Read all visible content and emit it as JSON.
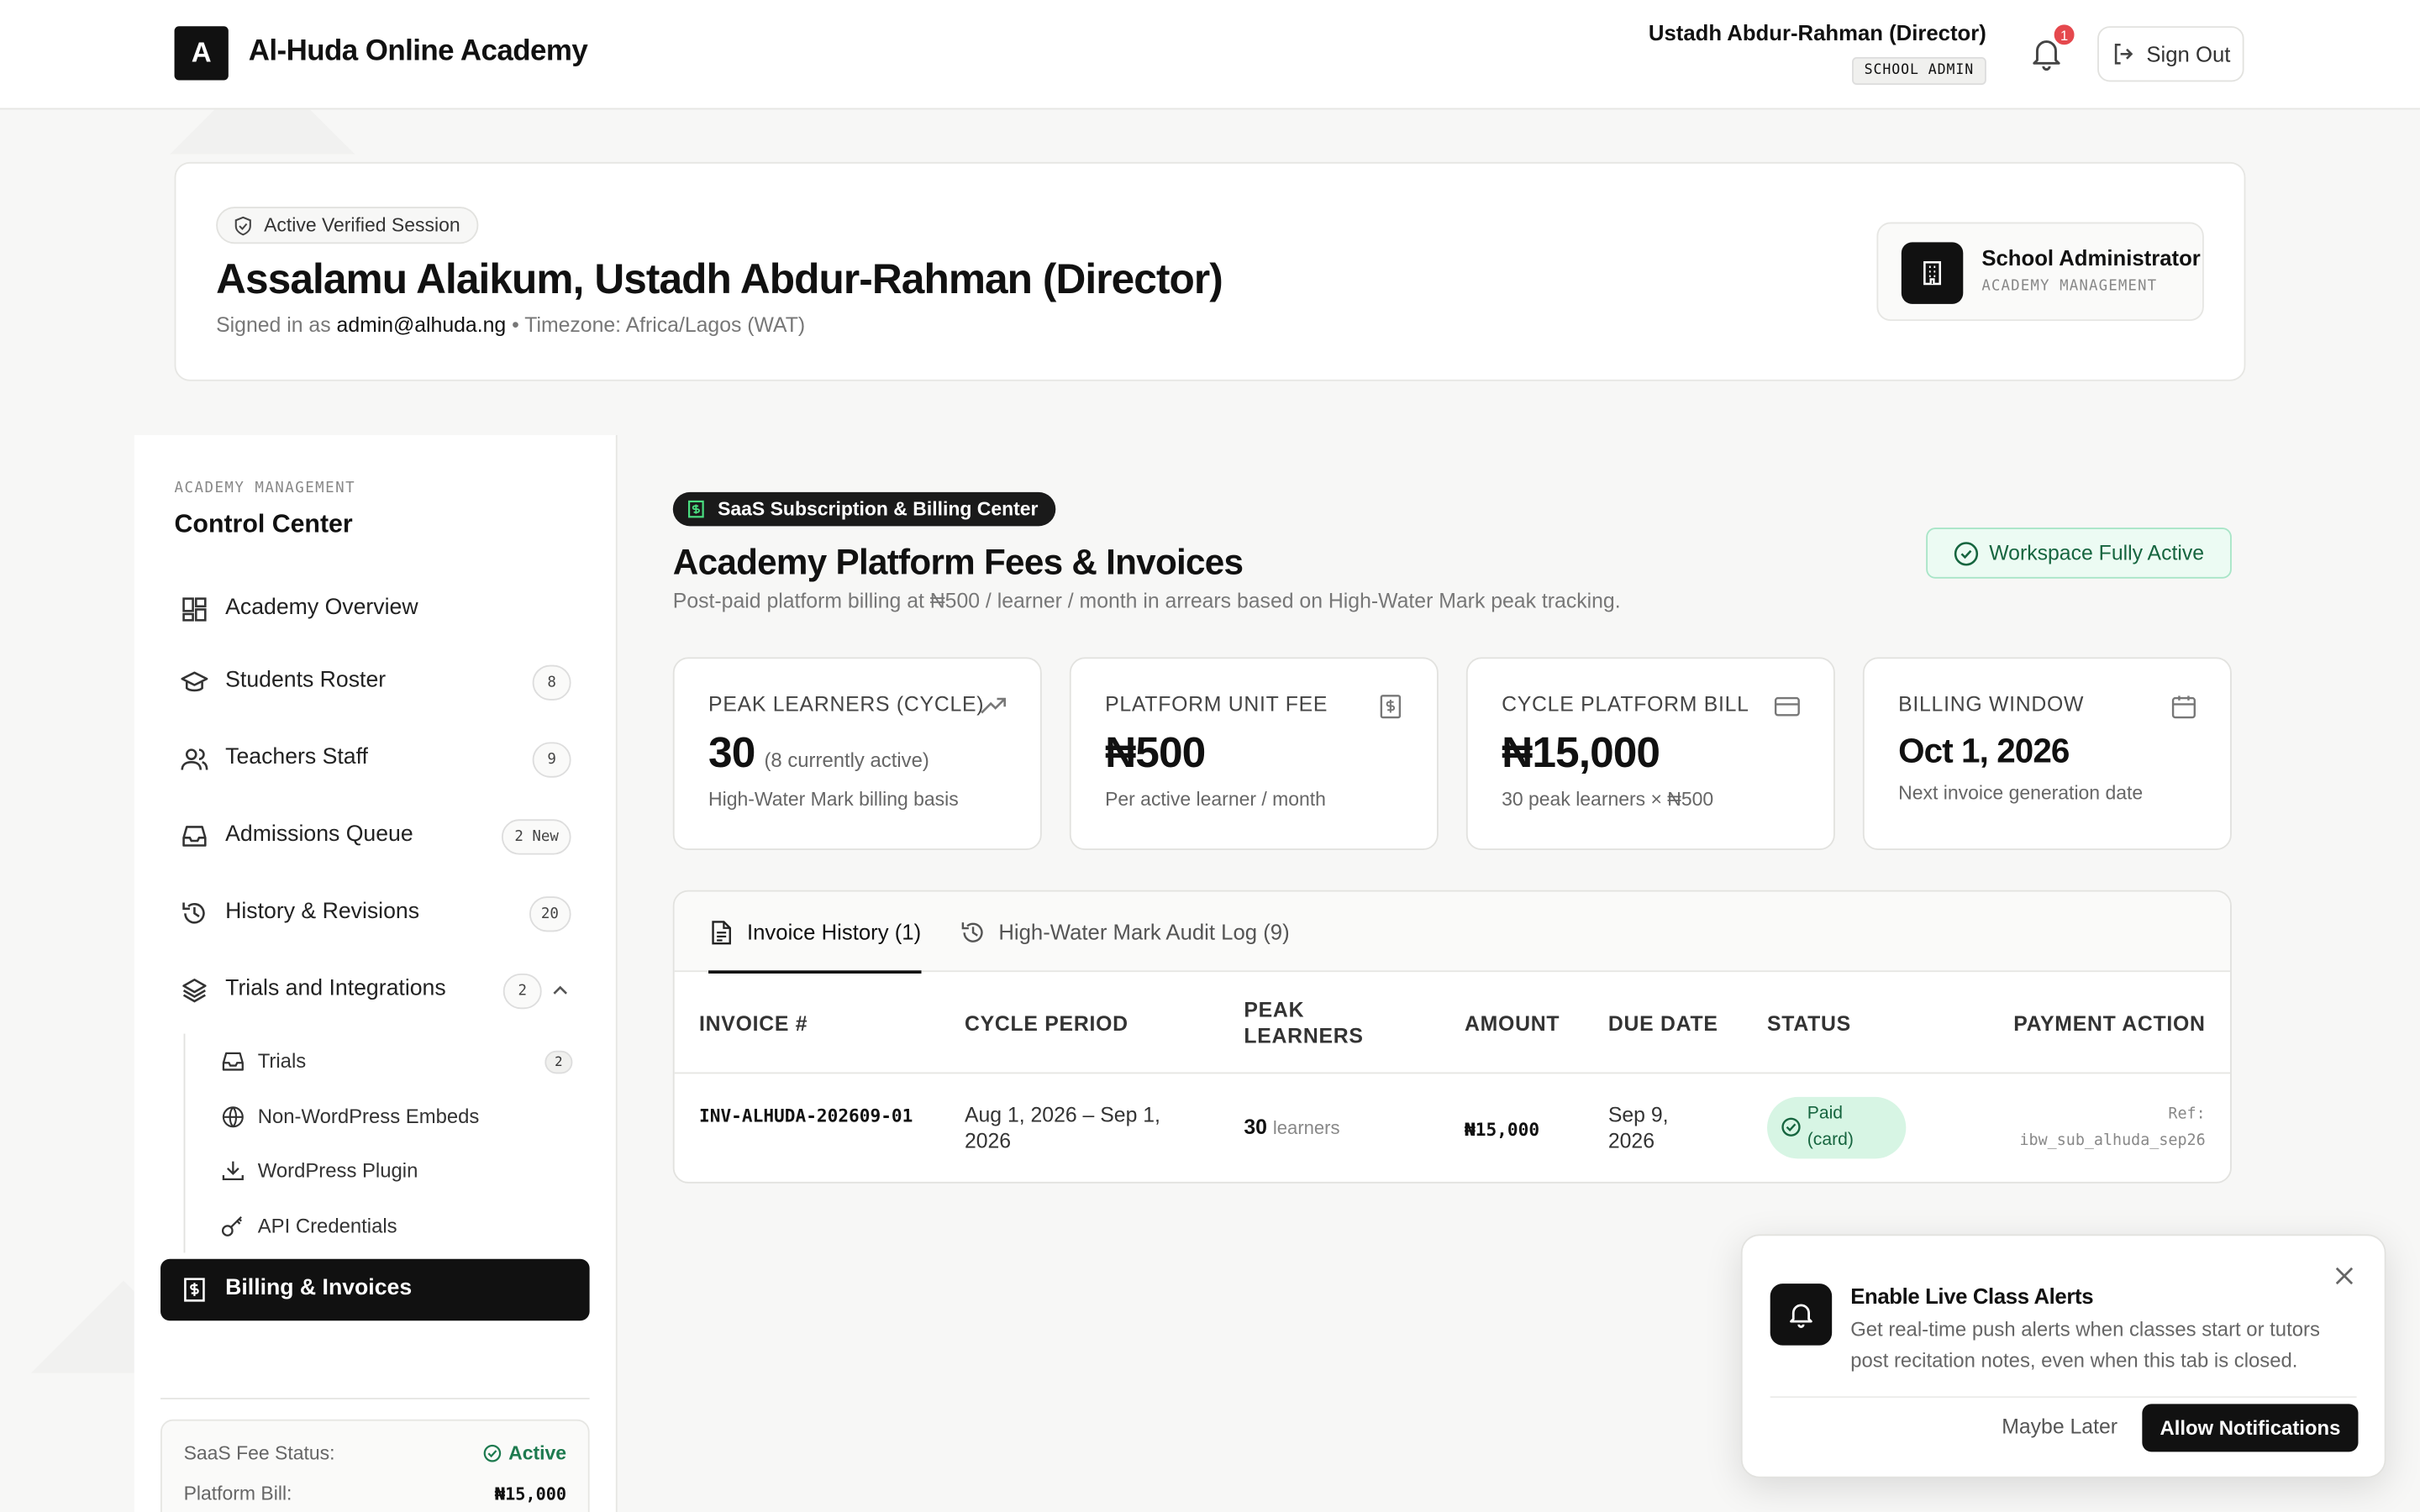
{
  "header": {
    "logo_letter": "A",
    "brand": "Al-Huda Online Academy",
    "user_name": "Ustadh Abdur-Rahman (Director)",
    "user_role": "SCHOOL ADMIN",
    "notification_count": "1",
    "signout_label": "Sign Out"
  },
  "welcome": {
    "session_badge": "Active Verified Session",
    "greeting": "Assalamu Alaikum, Ustadh Abdur-Rahman (Director)",
    "signed_prefix": "Signed in as",
    "email": "admin@alhuda.ng",
    "timezone": "• Timezone: Africa/Lagos (WAT)",
    "role_title": "School Administrator",
    "role_sub": "ACADEMY MANAGEMENT"
  },
  "sidebar": {
    "kicker": "ACADEMY MANAGEMENT",
    "title": "Control Center",
    "items": [
      {
        "label": "Academy Overview",
        "icon": "dashboard-icon",
        "count": ""
      },
      {
        "label": "Students Roster",
        "icon": "graduation-cap-icon",
        "count": "8"
      },
      {
        "label": "Teachers Staff",
        "icon": "users-icon",
        "count": "9"
      },
      {
        "label": "Admissions Queue",
        "icon": "inbox-icon",
        "count": "2 New"
      },
      {
        "label": "History & Revisions",
        "icon": "history-icon",
        "count": "20"
      },
      {
        "label": "Trials and Integrations",
        "icon": "layers-icon",
        "count": "2"
      },
      {
        "label": "Billing & Invoices",
        "icon": "receipt-icon",
        "count": ""
      }
    ],
    "sub_items": [
      {
        "label": "Trials",
        "icon": "inbox-icon",
        "count": "2"
      },
      {
        "label": "Non-WordPress Embeds",
        "icon": "globe-icon",
        "count": ""
      },
      {
        "label": "WordPress Plugin",
        "icon": "download-icon",
        "count": ""
      },
      {
        "label": "API Credentials",
        "icon": "key-icon",
        "count": ""
      }
    ],
    "fee_status_label": "SaaS Fee Status:",
    "fee_status_value": "Active",
    "platform_bill_label": "Platform Bill:",
    "platform_bill_value": "₦15,000"
  },
  "main": {
    "section_pill": "SaaS Subscription & Billing Center",
    "title": "Academy Platform Fees & Invoices",
    "subtitle": "Post-paid platform billing at ₦500 / learner / month in arrears based on High-Water Mark peak tracking.",
    "workspace_status": "Workspace Fully Active",
    "stats": [
      {
        "label": "PEAK LEARNERS (CYCLE)",
        "icon": "trending-up-icon",
        "value": "30",
        "aside": "(8 currently active)",
        "caption": "High-Water Mark billing basis"
      },
      {
        "label": "PLATFORM UNIT FEE",
        "icon": "receipt-icon",
        "value": "₦500",
        "aside": "",
        "caption": "Per active learner / month"
      },
      {
        "label": "CYCLE PLATFORM BILL",
        "icon": "credit-card-icon",
        "value": "₦15,000",
        "aside": "",
        "caption": "30 peak learners × ₦500"
      },
      {
        "label": "BILLING WINDOW",
        "icon": "calendar-icon",
        "value": "Oct 1, 2026",
        "aside": "",
        "caption": "Next invoice generation date"
      }
    ],
    "tabs": [
      {
        "label": "Invoice History (1)",
        "icon": "file-text-icon"
      },
      {
        "label": "High-Water Mark Audit Log (9)",
        "icon": "history-icon"
      }
    ],
    "columns": [
      "INVOICE #",
      "CYCLE PERIOD",
      "PEAK LEARNERS",
      "AMOUNT",
      "DUE DATE",
      "STATUS",
      "PAYMENT ACTION"
    ],
    "rows": [
      {
        "invoice": "INV-ALHUDA-202609-01",
        "period": "Aug 1, 2026 – Sep 1, 2026",
        "peak": "30",
        "peak_unit": "learners",
        "amount": "₦15,000",
        "due": "Sep 9, 2026",
        "status": "Paid (card)",
        "ref_label": "Ref:",
        "ref": "ibw_sub_alhuda_sep26"
      }
    ]
  },
  "toast": {
    "title": "Enable Live Class Alerts",
    "body": "Get real-time push alerts when classes start or tutors post recitation notes, even when this tab is closed.",
    "later_label": "Maybe Later",
    "allow_label": "Allow Notifications"
  },
  "colors": {
    "accent": "#111111",
    "success_bg": "#ecfbf3",
    "success_text": "#16653f",
    "badge_red": "#e5484d"
  }
}
